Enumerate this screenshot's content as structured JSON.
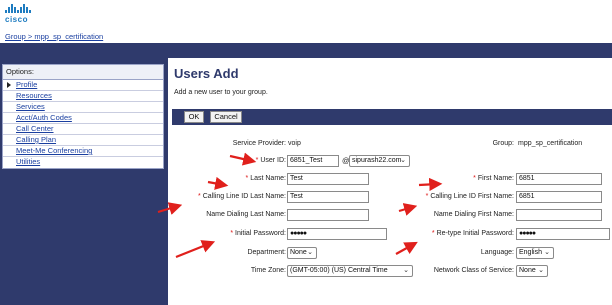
{
  "header": {
    "logo_text": "cisco",
    "breadcrumb": "Group > mpp_sp_certification"
  },
  "sidebar": {
    "title": "Options:",
    "items": [
      {
        "label": "Profile",
        "active": true
      },
      {
        "label": "Resources"
      },
      {
        "label": "Services"
      },
      {
        "label": "Acct/Auth Codes"
      },
      {
        "label": "Call Center"
      },
      {
        "label": "Calling Plan"
      },
      {
        "label": "Meet-Me Conferencing"
      },
      {
        "label": "Utilities"
      }
    ]
  },
  "main": {
    "title": "Users Add",
    "subtitle": "Add a new user to your group.",
    "buttons": {
      "ok": "OK",
      "cancel": "Cancel"
    }
  },
  "form": {
    "service_provider": {
      "label": "Service Provider:",
      "value": "voip"
    },
    "group": {
      "label": "Group:",
      "value": "mpp_sp_certification"
    },
    "user_id": {
      "label": "User ID:",
      "value": "6851_Test",
      "at": "@",
      "domain": "sipurash22.com"
    },
    "last_name": {
      "label": "Last Name:",
      "value": "Test"
    },
    "first_name": {
      "label": "First Name:",
      "value": "6851"
    },
    "cli_last_name": {
      "label": "Calling Line ID Last Name:",
      "value": "Test"
    },
    "cli_first_name": {
      "label": "Calling Line ID First Name:",
      "value": "6851"
    },
    "dial_last_name": {
      "label": "Name Dialing Last Name:",
      "value": ""
    },
    "dial_first_name": {
      "label": "Name Dialing First Name:",
      "value": ""
    },
    "initial_password": {
      "label": "Initial Password:",
      "value": "●●●●●"
    },
    "retype_password": {
      "label": "Re-type Initial Password:",
      "value": "●●●●●"
    },
    "department": {
      "label": "Department:",
      "value": "None"
    },
    "language": {
      "label": "Language:",
      "value": "English"
    },
    "time_zone": {
      "label": "Time Zone:",
      "value": "(GMT-05:00) (US) Central Time"
    },
    "network_class": {
      "label": "Network Class of Service:",
      "value": "None"
    },
    "required_marker": "*"
  },
  "colors": {
    "nav_bg": "#2f3a6c",
    "brand": "#1e7cc0",
    "link": "#1a3fa0",
    "annotation_arrow": "#e0201c"
  },
  "icons": [
    "cisco-logo-icon",
    "chevron-down-icon",
    "red-annotation-arrow",
    "active-item-triangle-icon"
  ]
}
